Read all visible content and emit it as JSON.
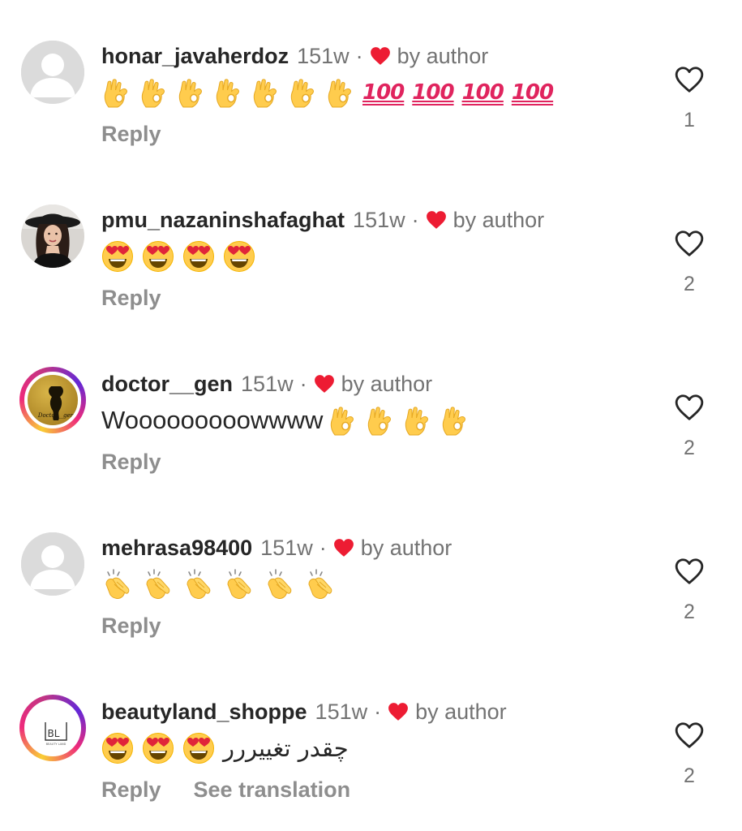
{
  "colors": {
    "username": "#262626",
    "meta": "#737373",
    "reply": "#8e8e8e",
    "heart_red": "#ed1c33",
    "default_avatar": "#dbdbdb"
  },
  "comments": [
    {
      "username": "honar_javaherdoz",
      "time": "151w",
      "separator": "·",
      "by_author": "by author",
      "avatar": "default",
      "text_emojis": [
        "ok-hand",
        "ok-hand",
        "ok-hand",
        "ok-hand",
        "ok-hand",
        "ok-hand",
        "ok-hand"
      ],
      "hundreds": [
        "100",
        "100",
        "100",
        "100"
      ],
      "reply_label": "Reply",
      "like_count": "1"
    },
    {
      "username": "pmu_nazaninshafaghat",
      "time": "151w",
      "separator": "·",
      "by_author": "by author",
      "avatar": "photo-woman-hat",
      "text_emojis": [
        "heart-eyes",
        "heart-eyes",
        "heart-eyes",
        "heart-eyes"
      ],
      "reply_label": "Reply",
      "like_count": "2"
    },
    {
      "username": "doctor__gen",
      "time": "151w",
      "separator": "·",
      "by_author": "by author",
      "avatar": "gold-logo-story",
      "avatar_text": "Doctor__gen",
      "text": "Wooooooooowwww",
      "text_emojis": [
        "ok-hand",
        "ok-hand",
        "ok-hand",
        "ok-hand"
      ],
      "reply_label": "Reply",
      "like_count": "2"
    },
    {
      "username": "mehrasa98400",
      "time": "151w",
      "separator": "·",
      "by_author": "by author",
      "avatar": "default",
      "text_emojis": [
        "clapping-hands",
        "clapping-hands",
        "clapping-hands",
        "clapping-hands",
        "clapping-hands",
        "clapping-hands"
      ],
      "reply_label": "Reply",
      "like_count": "2"
    },
    {
      "username": "beautyland_shoppe",
      "time": "151w",
      "separator": "·",
      "by_author": "by author",
      "avatar": "bl-logo-story",
      "avatar_text": "BL",
      "avatar_subtext": "BEAUTY LAND",
      "text_emojis": [
        "heart-eyes",
        "heart-eyes",
        "heart-eyes"
      ],
      "text": "چقدر تغییررر",
      "reply_label": "Reply",
      "see_translation": "See translation",
      "like_count": "2"
    }
  ]
}
